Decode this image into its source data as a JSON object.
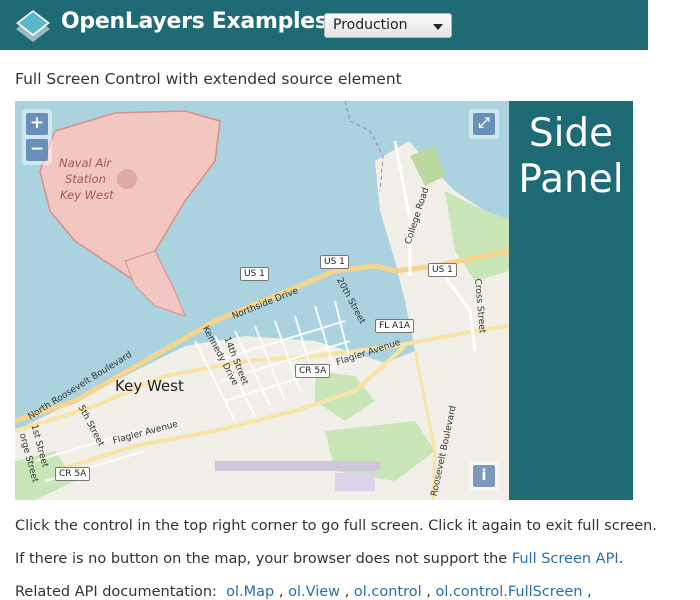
{
  "header": {
    "title": "OpenLayers Examples",
    "env_select": {
      "selected": "Production"
    }
  },
  "example": {
    "title": "Full Screen Control with extended source element"
  },
  "map": {
    "zoom_in": "+",
    "zoom_out": "−",
    "fullscreen_glyph": "⤢",
    "attribution": "i",
    "labels": {
      "naval_air": "Naval Air",
      "station": "Station",
      "key_west_base": "Key West",
      "key_west": "Key West",
      "northside": "Northside Drive",
      "kennedy": "Kennedy Drive",
      "st14": "14th Street",
      "st20": "20th Street",
      "college": "College Road",
      "cross": "Cross Street",
      "flagler_ave": "Flagler Avenue",
      "flagler_ave2": "Flagler Avenue",
      "north_roosevelt": "North Roosevelt Boulevard",
      "st5": "5th Street",
      "st1": "1st Street",
      "george": "orge Street",
      "roosevelt": "Roosevelt Boulevard"
    },
    "shields": {
      "us1a": "US 1",
      "us1b": "US 1",
      "us1c": "US 1",
      "fl1a": "FL A1A",
      "cr5a": "CR 5A",
      "cr5a2": "CR 5A"
    }
  },
  "side_panel": {
    "line1": "Side",
    "line2": "Panel"
  },
  "content": {
    "para1": "Click the control in the top right corner to go full screen. Click it again to exit full screen.",
    "para2_prefix": "If there is no button on the map, your browser does not support the ",
    "para2_link": "Full Screen API",
    "para2_suffix": ".",
    "related_label": "Related API documentation:",
    "api_links": [
      "ol.Map",
      "ol.View",
      "ol.control",
      "ol.control.FullScreen"
    ],
    "separator": ","
  },
  "colors": {
    "header_bg": "#1f6b75",
    "water": "#aad3df",
    "land": "#f2efe9",
    "link": "#2a6fb5"
  }
}
